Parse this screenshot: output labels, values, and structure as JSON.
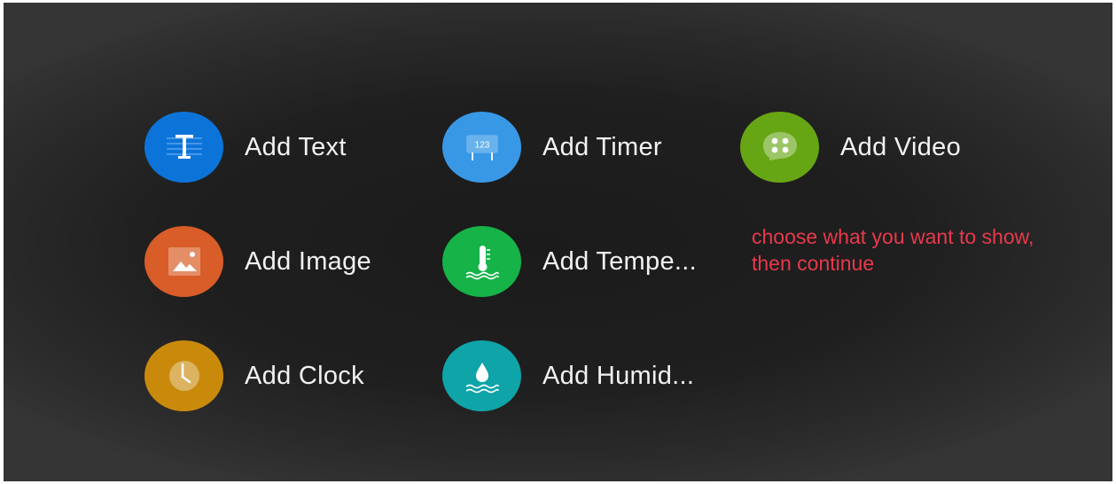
{
  "menu": {
    "items": [
      {
        "label": "Add Text",
        "icon": "text-icon",
        "color": "#0c74d9"
      },
      {
        "label": "Add Timer",
        "icon": "timer-icon",
        "color": "#3898e6",
        "icon_text": "123"
      },
      {
        "label": "Add Video",
        "icon": "video-icon",
        "color": "#66a614"
      },
      {
        "label": "Add Image",
        "icon": "image-icon",
        "color": "#d85d28"
      },
      {
        "label": "Add Tempe...",
        "icon": "thermometer-icon",
        "color": "#16b348"
      },
      {
        "label": "Add Clock",
        "icon": "clock-icon",
        "color": "#c98a0c"
      },
      {
        "label": "Add Humid...",
        "icon": "humidity-icon",
        "color": "#0fa4a8"
      }
    ]
  },
  "hint": {
    "text": "choose what you want to show, then continue",
    "color": "#e8394b"
  },
  "background": "#1f1f1f"
}
